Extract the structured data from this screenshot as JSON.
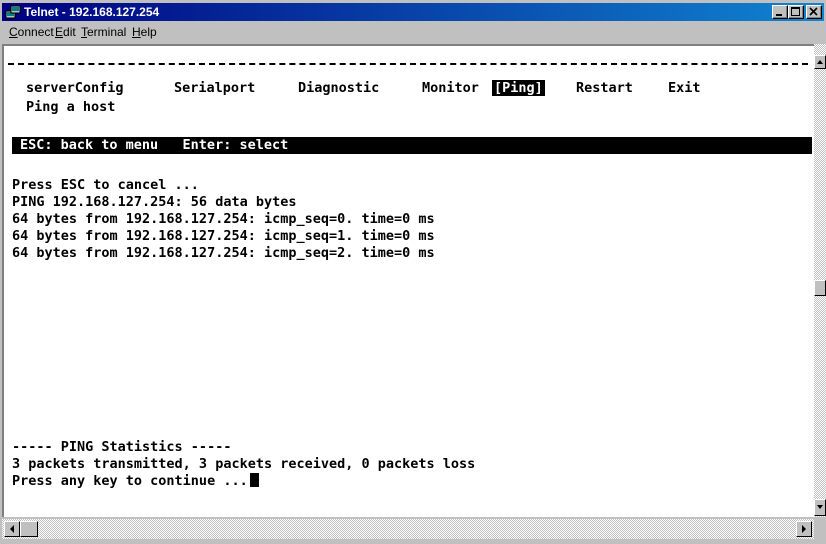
{
  "window": {
    "title": "Telnet - 192.168.127.254"
  },
  "menubar": {
    "items": [
      {
        "label": "Connect",
        "accel": "C",
        "rest": "onnect"
      },
      {
        "label": "Edit",
        "accel": "E",
        "rest": "dit"
      },
      {
        "label": "Terminal",
        "accel": "T",
        "rest": "erminal"
      },
      {
        "label": "Help",
        "accel": "H",
        "rest": "elp"
      }
    ]
  },
  "terminal": {
    "menu": [
      "serverConfig",
      "Serialport",
      "Diagnostic",
      "Monitor",
      "[Ping]",
      "Restart",
      "Exit"
    ],
    "active_menu": "[Ping]",
    "menu_description": "Ping a host",
    "status_bar": "ESC: back to menu   Enter: select",
    "output_lines": [
      "Press ESC to cancel ...",
      "PING 192.168.127.254: 56 data bytes",
      "64 bytes from 192.168.127.254: icmp_seq=0. time=0 ms",
      "64 bytes from 192.168.127.254: icmp_seq=1. time=0 ms",
      "64 bytes from 192.168.127.254: icmp_seq=2. time=0 ms"
    ],
    "stats_header": "----- PING Statistics -----",
    "stats_line": "3 packets transmitted, 3 packets received, 0 packets loss",
    "prompt": "Press any key to continue ..."
  },
  "colors": {
    "titlebar_start": "#000080",
    "titlebar_end": "#1084d0",
    "terminal_bg": "#ffffff",
    "terminal_fg": "#000000"
  }
}
